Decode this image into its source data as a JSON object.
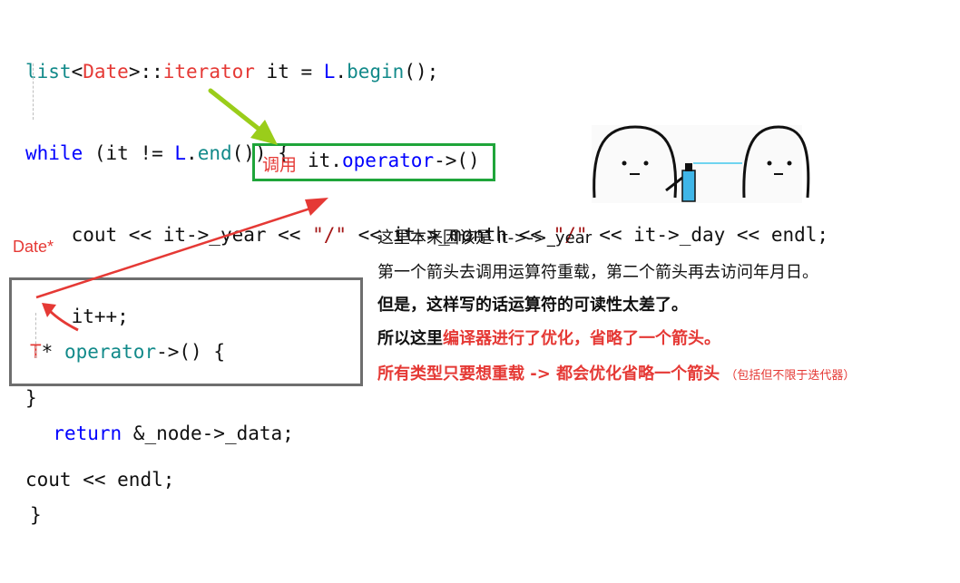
{
  "code_top": {
    "line1": {
      "t1": "list",
      "t2": "<",
      "t3": "Date",
      "t4": ">::",
      "t5": "iterator",
      "t6": " it = ",
      "t7": "L",
      ".": ".",
      "t8": "begin",
      "t9": "();"
    },
    "line2": {
      "t1": "while",
      "t2": " (it != ",
      "t3": "L",
      "t4": ".",
      "t5": "end",
      "t6": "()) {"
    },
    "line3": {
      "t1": "cout",
      "t2": " << it->_year << ",
      "t3": "\"/\"",
      "t4": " << it->_month << ",
      "t5": "\"/\"",
      "t6": " << it->_day << ",
      "t7": "endl",
      "t8": ";"
    },
    "line4": "it++;",
    "line5": "}",
    "line6": {
      "t1": "cout",
      "t2": " << ",
      "t3": "endl",
      "t4": ";"
    }
  },
  "green_box": {
    "cn_label": "调用",
    "code1": "it.",
    "code2": "operator",
    "code3": "->()"
  },
  "date_label": "Date*",
  "code_box": {
    "line1": {
      "t1": "T",
      "t2": "* ",
      "t3": "operator",
      "t4": "->() {"
    },
    "line2": {
      "t1": "return",
      "t2": " &_node->_data;"
    },
    "line3": "}"
  },
  "notes": {
    "line1": "这里本来因该是 it->->_year",
    "line2": "第一个箭头去调用运算符重载，第二个箭头再去访问年月日。",
    "line3": "但是，这样写的话运算符的可读性太差了。",
    "line4_a": "所以这里",
    "line4_b": "编译器进行了优化，省略了一个箭头。",
    "line5": "所有类型只要想重载 -> 都会优化省略一个箭头",
    "line5_small": "（包括但不限于迭代器）"
  },
  "colors": {
    "green_arrow": "#9acd1a",
    "red_arrow": "#e53935",
    "green_box": "#1fa53a",
    "gray_box": "#6e6e6e"
  },
  "icons": [
    "ghost-figure-spraying-icon",
    "ghost-figure-icon",
    "spray-can-icon"
  ]
}
